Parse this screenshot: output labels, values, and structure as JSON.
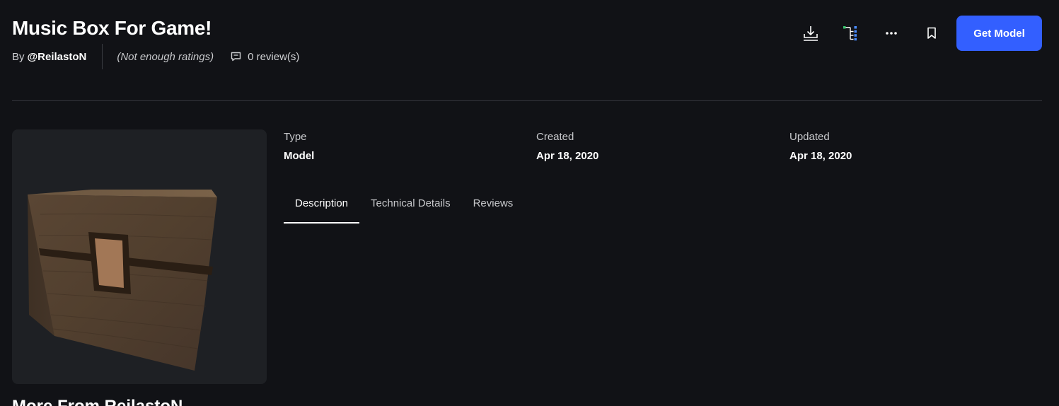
{
  "asset": {
    "title": "Music Box For Game!",
    "by_prefix": "By",
    "creator": "@ReilastoN",
    "ratings_text": "(Not enough ratings)",
    "reviews_text": "0 review(s)"
  },
  "actions": {
    "download_icon": "download-icon",
    "hierarchy_icon": "hierarchy-icon",
    "more_icon": "more-options-icon",
    "bookmark_icon": "bookmark-icon",
    "get_label": "Get Model",
    "accent_color": "#335fff"
  },
  "details": {
    "type_label": "Type",
    "type_value": "Model",
    "created_label": "Created",
    "created_value": "Apr 18, 2020",
    "updated_label": "Updated",
    "updated_value": "Apr 18, 2020"
  },
  "tabs": [
    {
      "label": "Description",
      "active": true
    },
    {
      "label": "Technical Details",
      "active": false
    },
    {
      "label": "Reviews",
      "active": false
    }
  ],
  "more_from_heading": "More From ReilastoN"
}
